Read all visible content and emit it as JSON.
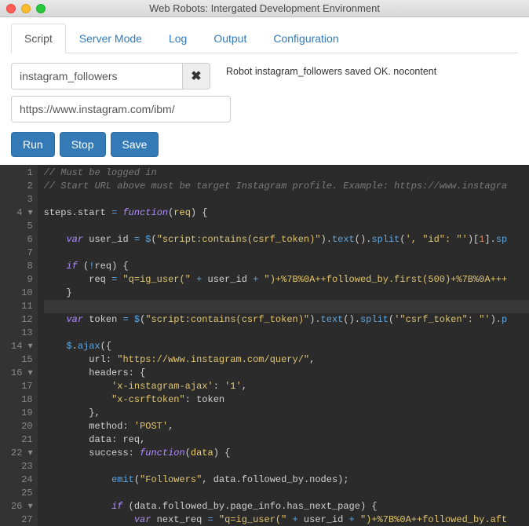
{
  "window": {
    "title": "Web Robots: Intergated Development Environment"
  },
  "tabs": {
    "script": "Script",
    "server": "Server Mode",
    "log": "Log",
    "output": "Output",
    "config": "Configuration"
  },
  "inputs": {
    "robot_name": "instagram_followers",
    "url": "https://www.instagram.com/ibm/"
  },
  "status": "Robot instagram_followers saved OK. nocontent",
  "buttons": {
    "run": "Run",
    "stop": "Stop",
    "save": "Save",
    "clear": "✖"
  },
  "code": {
    "lines": [
      {
        "n": 1,
        "t": "comment",
        "text": "// Must be logged in"
      },
      {
        "n": 2,
        "t": "comment",
        "text": "// Start URL above must be target Instagram profile. Example: https://www.instagra"
      },
      {
        "n": 3,
        "t": "blank",
        "text": ""
      },
      {
        "n": 4,
        "fold": true
      },
      {
        "n": 5,
        "t": "blank",
        "text": ""
      },
      {
        "n": 6
      },
      {
        "n": 7,
        "t": "blank",
        "text": ""
      },
      {
        "n": 8
      },
      {
        "n": 9
      },
      {
        "n": 10
      },
      {
        "n": 11,
        "t": "blank",
        "hl": true,
        "text": ""
      },
      {
        "n": 12
      },
      {
        "n": 13,
        "t": "blank",
        "text": ""
      },
      {
        "n": 14,
        "fold": true
      },
      {
        "n": 15
      },
      {
        "n": 16,
        "fold": true
      },
      {
        "n": 17
      },
      {
        "n": 18
      },
      {
        "n": 19
      },
      {
        "n": 20
      },
      {
        "n": 21
      },
      {
        "n": 22,
        "fold": true
      },
      {
        "n": 23,
        "t": "blank",
        "text": ""
      },
      {
        "n": 24
      },
      {
        "n": 25,
        "t": "blank",
        "text": ""
      },
      {
        "n": 26,
        "fold": true
      },
      {
        "n": 27
      }
    ],
    "s": {
      "l4a": "steps",
      "l4b": "start",
      "l4c": "function",
      "l4d": "req",
      "l6a": "var",
      "l6b": "user_id",
      "l6c": "$",
      "l6d": "\"script:contains(csrf_token)\"",
      "l6e": "text",
      "l6f": "split",
      "l6g": "', \"id\": \"'",
      "l6h": "1",
      "l6i": "sp",
      "l8a": "if",
      "l8b": "req",
      "l9a": "req",
      "l9b": "\"q=ig_user(\"",
      "l9c": "user_id",
      "l9d": "\")+%7B%0A++followed_by.first(500)+%7B%0A+++",
      "l12a": "var",
      "l12b": "token",
      "l12c": "$",
      "l12d": "\"script:contains(csrf_token)\"",
      "l12e": "text",
      "l12f": "split",
      "l12g": "'\"csrf_token\": \"'",
      "l12h": "p",
      "l14a": "$",
      "l14b": "ajax",
      "l15a": "url",
      "l15b": "\"https://www.instagram.com/query/\"",
      "l16a": "headers",
      "l17a": "'x-instagram-ajax'",
      "l17b": "'1'",
      "l18a": "\"x-csrftoken\"",
      "l18b": "token",
      "l20a": "method",
      "l20b": "'POST'",
      "l21a": "data",
      "l21b": "req",
      "l22a": "success",
      "l22b": "function",
      "l22c": "data",
      "l24a": "emit",
      "l24b": "\"Followers\"",
      "l24c": "data",
      "l24d": "followed_by",
      "l24e": "nodes",
      "l26a": "if",
      "l26b": "data",
      "l26c": "followed_by",
      "l26d": "page_info",
      "l26e": "has_next_page",
      "l27a": "var",
      "l27b": "next_req",
      "l27c": "\"q=ig_user(\"",
      "l27d": "user_id",
      "l27e": "\")+%7B%0A++followed_by.aft"
    }
  }
}
